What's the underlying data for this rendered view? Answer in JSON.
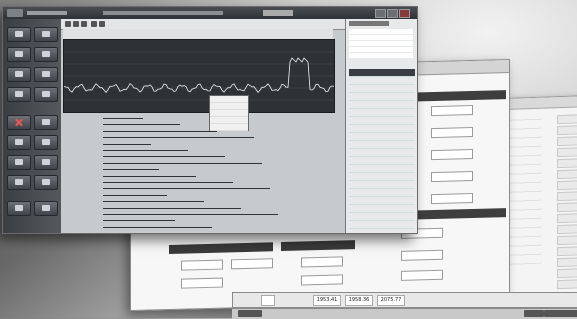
{
  "app": {
    "title": "",
    "window_controls": [
      "minimize",
      "maximize",
      "close"
    ]
  },
  "front_window": {
    "left_toolbar_icons": [
      "record-icon",
      "save-icon",
      "print-icon",
      "zoom-icon",
      "delete-icon",
      "mark-icon",
      "event-icon",
      "settings-icon",
      "power-icon",
      "export-icon"
    ],
    "trend_chart": {
      "type": "line",
      "series_color": "#f2f2f2",
      "background": "#2e3135",
      "grid": true
    },
    "channel_rows": 18,
    "context_menu_rows": 5,
    "right_panel_rows": 26
  },
  "form_window": {
    "rows": [
      "",
      "",
      "",
      "",
      ""
    ],
    "fields": [
      "",
      "",
      "",
      "",
      "",
      "",
      "",
      "",
      ""
    ],
    "bottom_buttons": [
      "",
      "",
      "",
      "",
      "",
      ""
    ]
  },
  "bottom_strip": {
    "values": [
      "1953.41",
      "1958.36",
      "2075.77"
    ]
  },
  "colors": {
    "sidebar": "#3b3e43",
    "titlebar": "#2f3236",
    "section_header": "#3e3e3e"
  }
}
